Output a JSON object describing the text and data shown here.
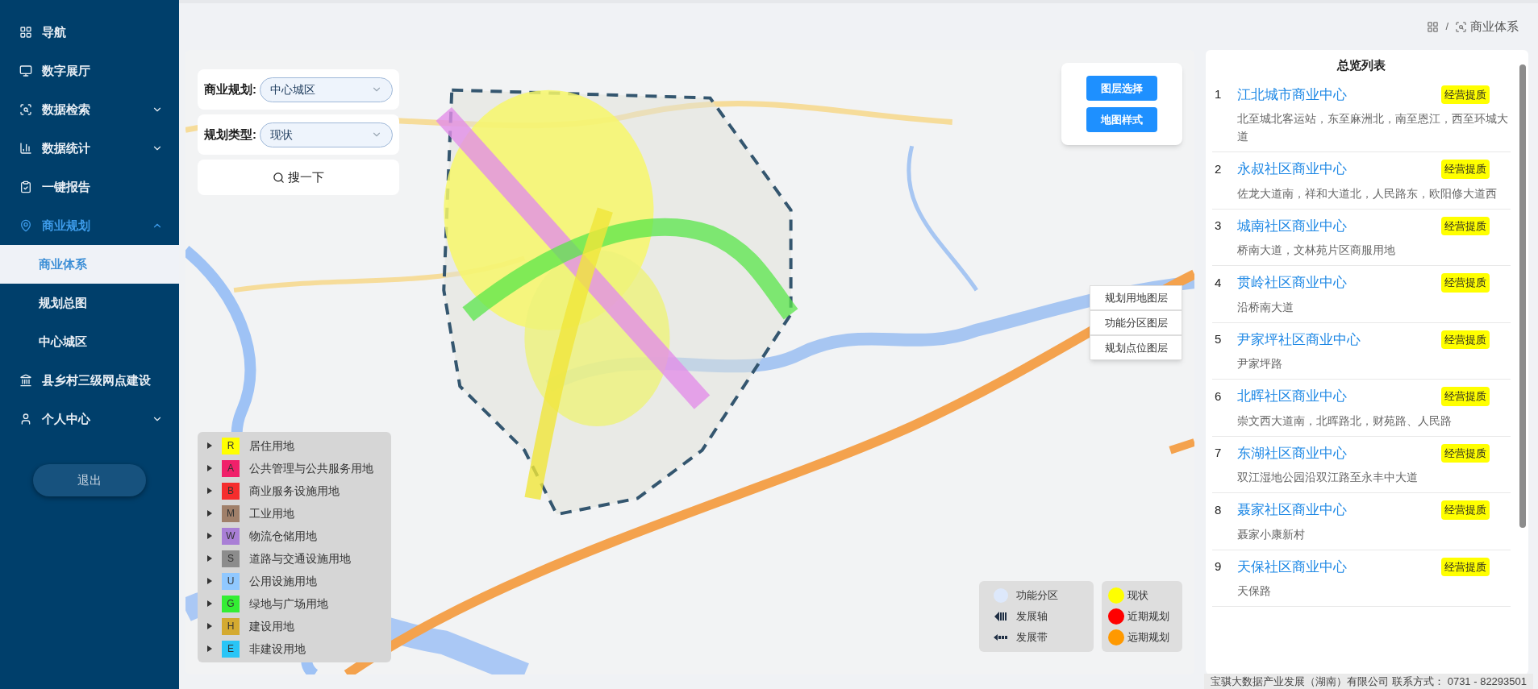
{
  "sidebar": {
    "items": [
      {
        "label": "导航",
        "selected": false
      },
      {
        "label": "数字展厅",
        "selected": false
      },
      {
        "label": "数据检索",
        "selected": false,
        "expanded": false
      },
      {
        "label": "数据统计",
        "selected": false,
        "expanded": false
      },
      {
        "label": "一键报告",
        "selected": false
      },
      {
        "label": "商业规划",
        "selected": true,
        "expanded": true,
        "children": [
          {
            "label": "商业体系",
            "selected": true
          },
          {
            "label": "规划总图",
            "selected": false
          },
          {
            "label": "中心城区",
            "selected": false
          }
        ]
      },
      {
        "label": "县乡村三级网点建设",
        "selected": false
      },
      {
        "label": "个人中心",
        "selected": false,
        "expanded": false
      }
    ],
    "logout": "退出"
  },
  "breadcrumb": {
    "separator": "/",
    "current": "商业体系"
  },
  "map": {
    "filters": [
      {
        "label": "商业规划:",
        "value": "中心城区"
      },
      {
        "label": "规划类型:",
        "value": "现状"
      }
    ],
    "search_button": "搜一下",
    "map_buttons": [
      "图层选择",
      "地图样式"
    ],
    "layer_buttons": [
      "规划用地图层",
      "功能分区图层",
      "规划点位图层"
    ],
    "land_legend": [
      {
        "code": "R",
        "label": "居住用地",
        "color": "#ffff00"
      },
      {
        "code": "A",
        "label": "公共管理与公共服务用地",
        "color": "#f0206a"
      },
      {
        "code": "B",
        "label": "商业服务设施用地",
        "color": "#f52d2d"
      },
      {
        "code": "M",
        "label": "工业用地",
        "color": "#a0806a"
      },
      {
        "code": "W",
        "label": "物流仓储用地",
        "color": "#a97fd6"
      },
      {
        "code": "S",
        "label": "道路与交通设施用地",
        "color": "#8c8c8c"
      },
      {
        "code": "U",
        "label": "公用设施用地",
        "color": "#90c8ff"
      },
      {
        "code": "G",
        "label": "绿地与广场用地",
        "color": "#33ee33"
      },
      {
        "code": "H",
        "label": "建设用地",
        "color": "#d4aa30"
      },
      {
        "code": "E",
        "label": "非建设用地",
        "color": "#29c5f6"
      }
    ],
    "function_legend": [
      {
        "kind": "zone",
        "label": "功能分区"
      },
      {
        "kind": "axis",
        "label": "发展轴"
      },
      {
        "kind": "belt",
        "label": "发展带"
      }
    ],
    "status_legend": [
      {
        "label": "现状",
        "color": "#ffff00"
      },
      {
        "label": "近期规划",
        "color": "#ff0000"
      },
      {
        "label": "远期规划",
        "color": "#ff9900"
      }
    ]
  },
  "overview": {
    "title": "总览列表",
    "items": [
      {
        "index": "1",
        "name": "江北城市商业中心",
        "tag": "经营提质",
        "desc": "北至城北客运站，东至麻洲北，南至恩江，西至环城大道"
      },
      {
        "index": "2",
        "name": "永叔社区商业中心",
        "tag": "经营提质",
        "desc": "佐龙大道南，祥和大道北，人民路东，欧阳修大道西"
      },
      {
        "index": "3",
        "name": "城南社区商业中心",
        "tag": "经营提质",
        "desc": "桥南大道，文林苑片区商服用地"
      },
      {
        "index": "4",
        "name": "贯岭社区商业中心",
        "tag": "经营提质",
        "desc": "沿桥南大道"
      },
      {
        "index": "5",
        "name": "尹家坪社区商业中心",
        "tag": "经营提质",
        "desc": "尹家坪路"
      },
      {
        "index": "6",
        "name": "北晖社区商业中心",
        "tag": "经营提质",
        "desc": "崇文西大道南，北晖路北，财苑路、人民路"
      },
      {
        "index": "7",
        "name": "东湖社区商业中心",
        "tag": "经营提质",
        "desc": "双江湿地公园沿双江路至永丰中大道"
      },
      {
        "index": "8",
        "name": "聂家社区商业中心",
        "tag": "经营提质",
        "desc": "聂家小康新村"
      },
      {
        "index": "9",
        "name": "天保社区商业中心",
        "tag": "经营提质",
        "desc": "天保路"
      }
    ]
  },
  "footer": "宝骐大数据产业发展（湖南）有限公司 联系方式： 0731 - 82293501"
}
